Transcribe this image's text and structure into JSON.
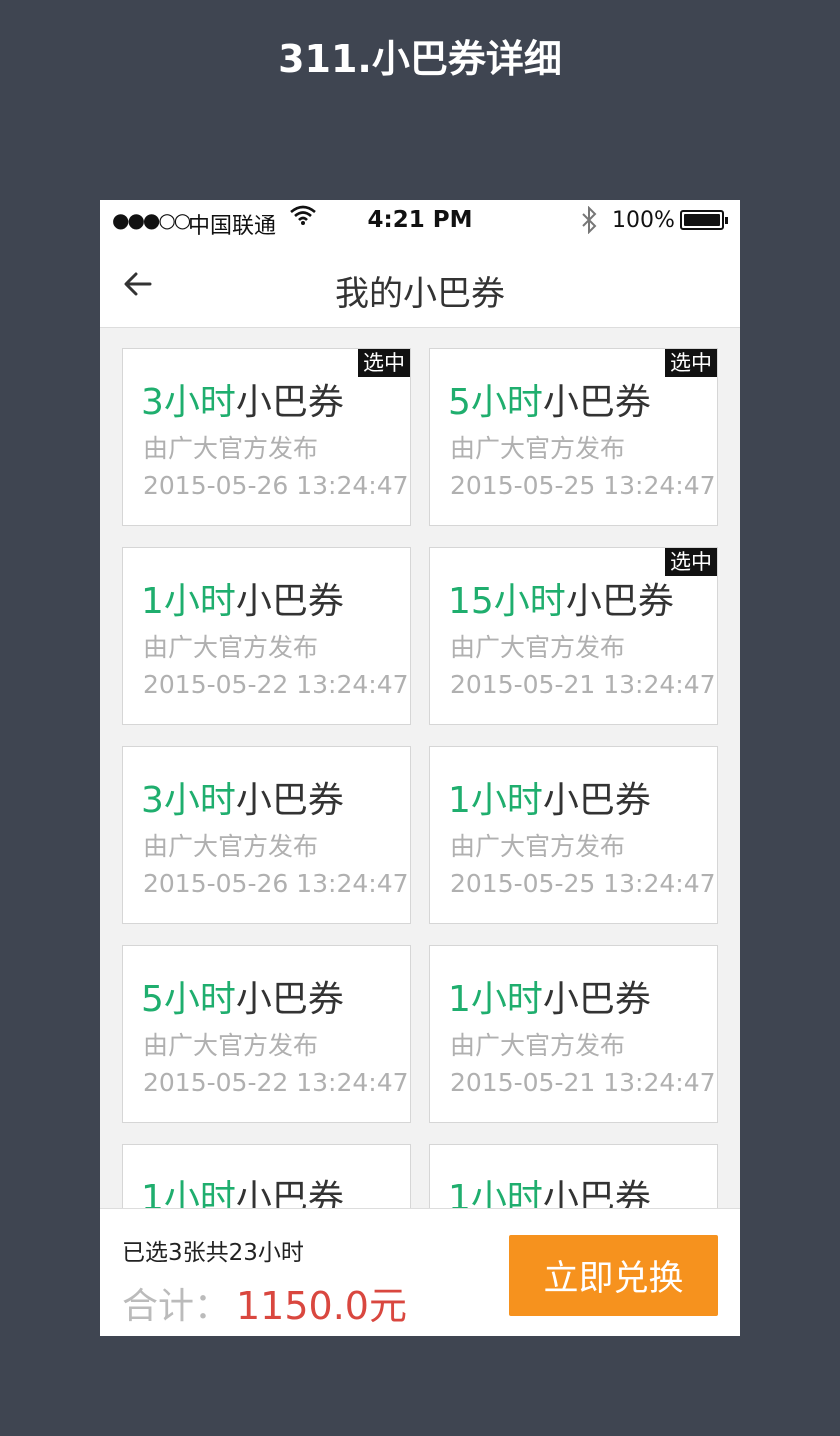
{
  "page_heading": "311.小巴券详细",
  "status_bar": {
    "signal": "●●●○○",
    "carrier": "中国联通",
    "time": "4:21 PM",
    "battery": "100%"
  },
  "nav": {
    "title": "我的小巴券"
  },
  "coupon_suffix": "小巴券",
  "coupons": [
    {
      "hours": "3小时",
      "publisher": "由广大官方发布",
      "date": "2015-05-26 13:24:47",
      "badge": "选中"
    },
    {
      "hours": "5小时",
      "publisher": "由广大官方发布",
      "date": "2015-05-25 13:24:47",
      "badge": "选中"
    },
    {
      "hours": "1小时",
      "publisher": "由广大官方发布",
      "date": "2015-05-22 13:24:47",
      "badge": ""
    },
    {
      "hours": "15小时",
      "publisher": "由广大官方发布",
      "date": "2015-05-21 13:24:47",
      "badge": "选中"
    },
    {
      "hours": "3小时",
      "publisher": "由广大官方发布",
      "date": "2015-05-26 13:24:47",
      "badge": ""
    },
    {
      "hours": "1小时",
      "publisher": "由广大官方发布",
      "date": "2015-05-25 13:24:47",
      "badge": ""
    },
    {
      "hours": "5小时",
      "publisher": "由广大官方发布",
      "date": "2015-05-22 13:24:47",
      "badge": ""
    },
    {
      "hours": "1小时",
      "publisher": "由广大官方发布",
      "date": "2015-05-21 13:24:47",
      "badge": ""
    },
    {
      "hours": "1小时",
      "publisher": "",
      "date": "",
      "badge": ""
    },
    {
      "hours": "1小时",
      "publisher": "",
      "date": "",
      "badge": ""
    }
  ],
  "footer": {
    "summary": "已选3张共23小时",
    "total_label": "合计：",
    "total_value": "1150.0元",
    "redeem_label": "立即兑换"
  },
  "colors": {
    "accent_green": "#1fae6e",
    "price_red": "#d9473f",
    "button_orange": "#f6921e",
    "backdrop": "#3f4551"
  },
  "icons": {
    "back": "back-arrow-icon",
    "wifi": "wifi-icon",
    "bluetooth": "bluetooth-icon",
    "battery": "battery-icon"
  }
}
